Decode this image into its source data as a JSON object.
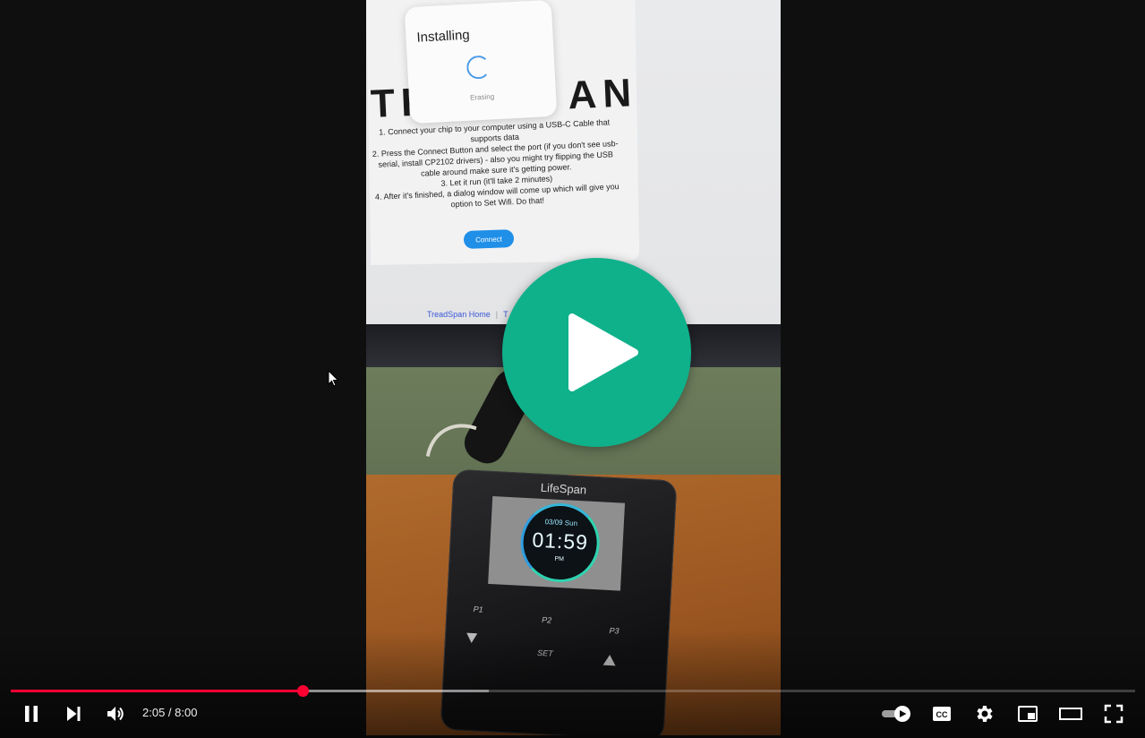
{
  "video_frame": {
    "installing_dialog": {
      "title": "Installing",
      "status": "Erasing"
    },
    "brand_text": "TR",
    "brand_text_right": "AN",
    "instructions": [
      "1. Connect your chip to your computer using a USB-C Cable that supports data",
      "2. Press the Connect Button and select the port (if you don't see usb-serial, install CP2102 drivers) - also you might try flipping the USB cable around make sure it's getting power.",
      "3. Let it run (it'll take 2 minutes)",
      "4. After it's finished, a dialog window will come up which will give you option to Set Wifi. Do that!"
    ],
    "connect_button": "Connect",
    "footer_link_home": "TreadSpan Home",
    "footer_link_partial": "T",
    "console": {
      "brand": "LifeSpan",
      "date": "03/09 Sun",
      "clock": "01:59",
      "ampm": "PM",
      "key_p1": "P1",
      "key_p2": "P2",
      "key_p3": "P3",
      "key_set": "SET"
    }
  },
  "player": {
    "big_play_color": "#0fb18b",
    "progress": {
      "played_fraction": 0.26,
      "buffered_fraction": 0.425,
      "color": "#ff0033"
    },
    "time_display": "2:05 / 8:00",
    "controls": {
      "play_pause": "pause-icon",
      "next": "next-icon",
      "volume": "volume-icon",
      "autoplay": "autoplay-toggle",
      "captions": "captions-icon",
      "settings": "gear-icon",
      "miniplayer": "miniplayer-icon",
      "theater": "theater-icon",
      "fullscreen": "fullscreen-icon"
    }
  }
}
